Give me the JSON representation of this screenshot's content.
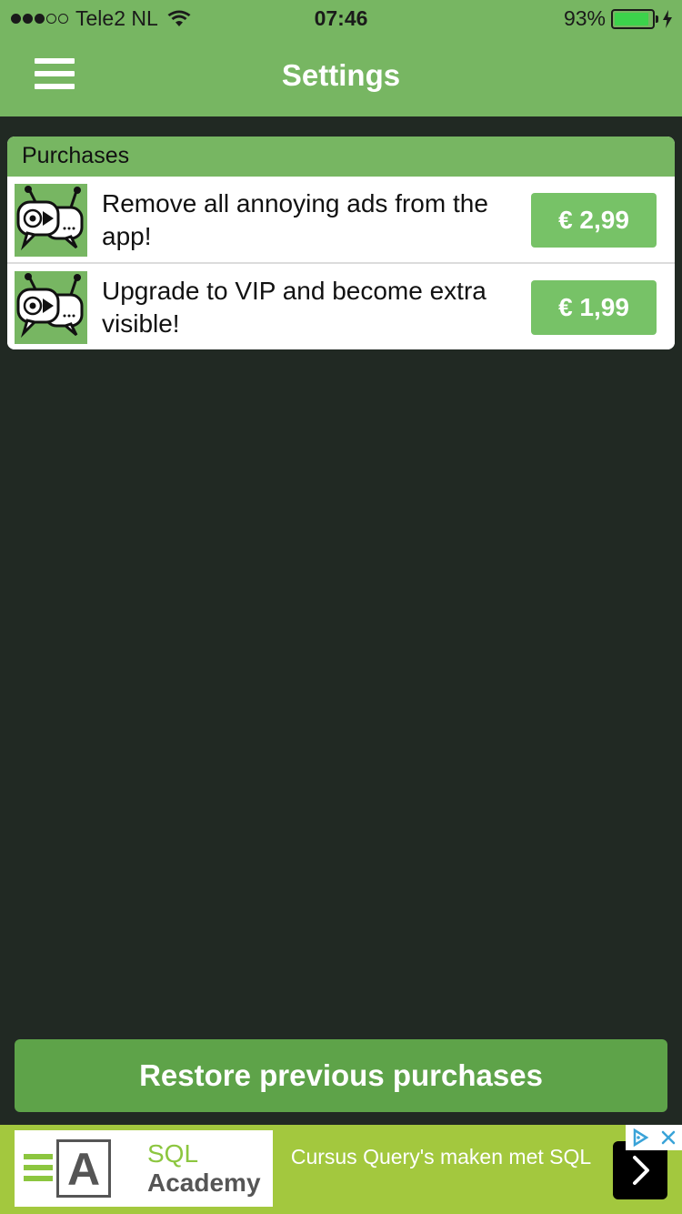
{
  "status_bar": {
    "carrier": "Tele2 NL",
    "time": "07:46",
    "battery_percent": "93%",
    "battery_level": 0.93,
    "signal_bars": 3
  },
  "nav": {
    "title": "Settings",
    "menu_icon": "hamburger-menu-icon"
  },
  "purchases": {
    "header": "Purchases",
    "items": [
      {
        "icon": "football-tv-chat-app-icon",
        "label": "Remove all annoying ads from the app!",
        "price": "€ 2,99"
      },
      {
        "icon": "football-tv-chat-app-icon",
        "label": "Upgrade to VIP and become extra visible!",
        "price": "€ 1,99"
      }
    ]
  },
  "restore_button": "Restore previous purchases",
  "ad": {
    "brand_line1": "SQL",
    "brand_line2": "Academy",
    "logo_letter": "A",
    "text": "Cursus Query's maken met SQL",
    "arrow_icon": "chevron-right-icon",
    "choices_icons": [
      "ad-choices-icon",
      "close-icon"
    ]
  },
  "colors": {
    "header_green": "#77b662",
    "background": "#212923",
    "price_button": "#77c267",
    "restore_button": "#5ea349",
    "ad_background": "#a3c83e"
  }
}
